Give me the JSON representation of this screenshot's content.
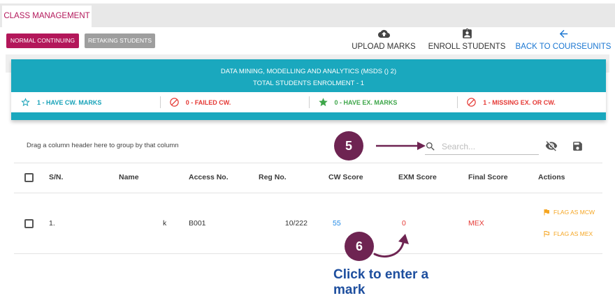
{
  "tabs": [
    {
      "label": "CLASS MANAGEMENT"
    }
  ],
  "filters": [
    {
      "label": "NORMAL CONTINUING",
      "selected": true
    },
    {
      "label": "RETAKING STUDENTS",
      "selected": false
    }
  ],
  "toolbar": {
    "actions": [
      {
        "icon": "cloud-upload-icon",
        "label": "UPLOAD MARKS"
      },
      {
        "icon": "assignment-ind-icon",
        "label": "ENROLL STUDENTS"
      },
      {
        "icon": "arrow-left-icon",
        "label": "BACK TO COURSEUNITS"
      }
    ]
  },
  "summary": {
    "course_title": "DATA MINING, MODELLING AND ANALYTICS (MSDS () 2)",
    "enrolment": "TOTAL STUDENTS ENROLMENT - 1",
    "stats": [
      {
        "icon": "star-outline-icon",
        "label": "1 - HAVE CW. MARKS",
        "color": "#17a2b8"
      },
      {
        "icon": "block-icon",
        "label": "0 - FAILED CW.",
        "color": "#e53935"
      },
      {
        "icon": "star-icon",
        "label": "0 - HAVE EX. MARKS",
        "color": "#3ea64a"
      },
      {
        "icon": "block-icon",
        "label": "1 - MISSING EX. OR CW.",
        "color": "#e53935"
      }
    ]
  },
  "grid": {
    "group_hint": "Drag a column header here to group by that column",
    "search_placeholder": "Search...",
    "tool_icons": [
      "search-icon",
      "eye-off-icon",
      "save-icon"
    ],
    "columns": [
      "S/N.",
      "Name",
      "Access No.",
      "Reg No.",
      "CW Score",
      "EXM Score",
      "Final Score",
      "Actions"
    ],
    "rows": [
      {
        "sn": "1.",
        "name": "k",
        "access_no": "B001",
        "reg_no": "10/222",
        "cw_score": "55",
        "exm_score": "0",
        "final_score": "MEX",
        "actions": [
          {
            "icon": "flag-icon",
            "label": "FLAG AS MCW"
          },
          {
            "icon": "outlined-flag-icon",
            "label": "FLAG AS MEX"
          }
        ]
      }
    ]
  },
  "callouts": [
    {
      "number": "5"
    },
    {
      "number": "6",
      "caption": "Click to enter a mark"
    }
  ],
  "colors": {
    "brand": "#b3175a",
    "teal": "#1aa8be",
    "red": "#e53935",
    "green": "#3ea64a",
    "link": "#1976d2",
    "cw_score": "#1e88e5",
    "flag": "#f5a623",
    "callout": "#6e2452",
    "hint": "#1d4e9e",
    "inactive": "#9e9e9e"
  }
}
